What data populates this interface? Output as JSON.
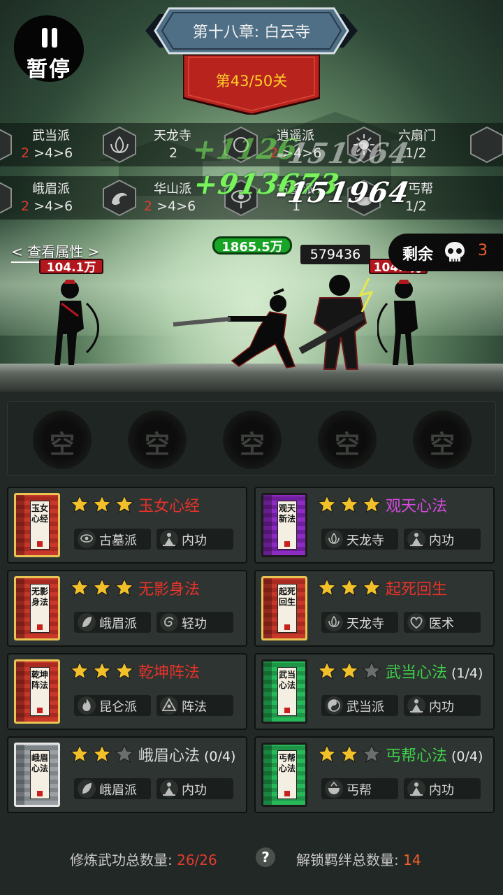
{
  "pause": {
    "label": "暂停"
  },
  "chapter": {
    "title": "第十八章: 白云寺"
  },
  "stage": {
    "label": "第43/50关"
  },
  "bonds": {
    "row1": [
      {
        "name": "武当派",
        "lv": [
          "2",
          ">4>6"
        ]
      },
      {
        "name": "天龙寺",
        "lv": [
          "2",
          ""
        ]
      },
      {
        "name": "逍遥派",
        "lv": [
          "2",
          ">4>6"
        ]
      },
      {
        "name": "六扇门",
        "lv": [
          "",
          "1/2"
        ]
      }
    ],
    "row2": [
      {
        "name": "峨眉派",
        "lv": [
          "2",
          ">4>6"
        ]
      },
      {
        "name": "华山派",
        "lv": [
          "2",
          ">4>6"
        ]
      },
      {
        "name": "古墓派",
        "lv": [
          "1",
          ""
        ]
      },
      {
        "name": "丐帮",
        "lv": [
          "",
          "1/2"
        ]
      }
    ]
  },
  "damage": {
    "green_faded": "+1126",
    "white_faded": "-151964",
    "green": "+913673",
    "white": "-151964"
  },
  "battle": {
    "inspect_label": "< 查看属性 >",
    "hp_left": "104.1万",
    "hp_player": "1865.5万",
    "hp_boss": "579436",
    "hp_right": "104.1万",
    "remaining_label": "剩余",
    "remaining_count": "3"
  },
  "slots": [
    "空",
    "空",
    "空",
    "空",
    "空"
  ],
  "cards": [
    {
      "book": "玉女心经",
      "stars": 3,
      "title": "玉女心经",
      "count": "",
      "color": "#e8322a",
      "tags": [
        "古墓派",
        "内功"
      ],
      "icons": [
        "eye-icon",
        "meditation-icon"
      ]
    },
    {
      "book": "观天新法",
      "stars": 3,
      "title": "观天心法",
      "count": "",
      "color": "#d64be0",
      "tags": [
        "天龙寺",
        "内功"
      ],
      "icons": [
        "lotus-icon",
        "meditation-icon"
      ]
    },
    {
      "book": "无影身法",
      "stars": 3,
      "title": "无影身法",
      "count": "",
      "color": "#e8322a",
      "tags": [
        "峨眉派",
        "轻功"
      ],
      "icons": [
        "leaf-icon",
        "swirl-icon"
      ]
    },
    {
      "book": "起死回生",
      "stars": 3,
      "title": "起死回生",
      "count": "",
      "color": "#e8322a",
      "tags": [
        "天龙寺",
        "医术"
      ],
      "icons": [
        "lotus-icon",
        "heart-icon"
      ]
    },
    {
      "book": "乾坤阵法",
      "stars": 3,
      "title": "乾坤阵法",
      "count": "",
      "color": "#e8322a",
      "tags": [
        "昆仑派",
        "阵法"
      ],
      "icons": [
        "flame-icon",
        "triangle-icon"
      ]
    },
    {
      "book": "武当心法",
      "stars": 2,
      "title": "武当心法",
      "count": "(1/4)",
      "color": "#3fd14a",
      "tags": [
        "武当派",
        "内功"
      ],
      "icons": [
        "yinyang-icon",
        "meditation-icon"
      ]
    },
    {
      "book": "峨眉心法",
      "stars": 2,
      "title": "峨眉心法",
      "count": "(0/4)",
      "color": "#d8d8d8",
      "tags": [
        "峨眉派",
        "内功"
      ],
      "icons": [
        "leaf-icon",
        "meditation-icon"
      ]
    },
    {
      "book": "丐帮心法",
      "stars": 2,
      "title": "丐帮心法",
      "count": "(0/4)",
      "color": "#3fd14a",
      "tags": [
        "丐帮",
        "内功"
      ],
      "icons": [
        "bowl-icon",
        "meditation-icon"
      ]
    }
  ],
  "card_books": [
    "red",
    "purple",
    "red",
    "red",
    "red",
    "green",
    "grey",
    "green"
  ],
  "footer": {
    "trained_label": "修炼武功总数量:",
    "trained_value": "26/26",
    "help": "?",
    "bonds_label": "解锁羁绊总数量:",
    "bonds_value": "14"
  },
  "colors": {
    "star": "#f2c12a",
    "star_empty": "#6b6f6c",
    "accent_red": "#e33b2f",
    "accent_orange": "#f0602a"
  }
}
